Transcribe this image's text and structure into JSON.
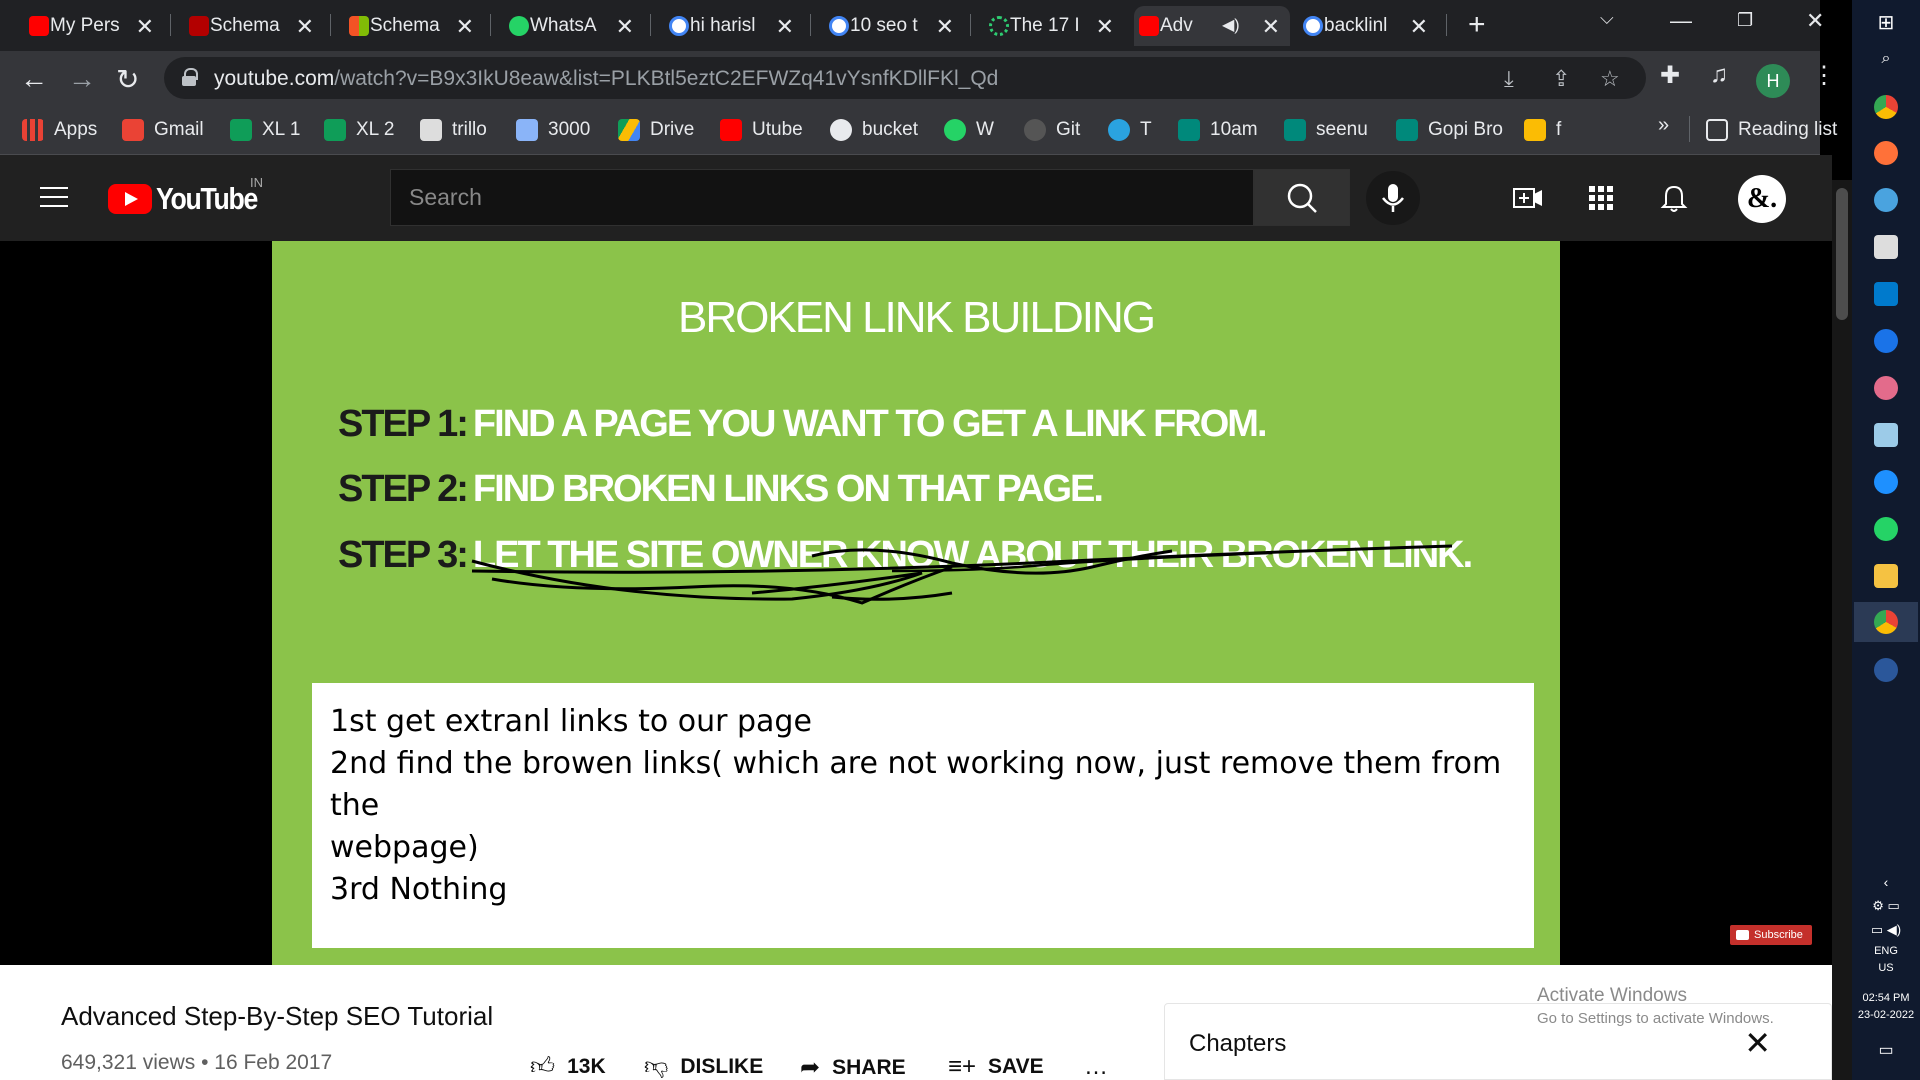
{
  "tabs": [
    {
      "title": "My Pers",
      "icon": "youtube-icon",
      "color": "#ff0000"
    },
    {
      "title": "Schema",
      "icon": "schema-org-icon",
      "color": "#b30000"
    },
    {
      "title": "Schema",
      "icon": "microsoft-icon",
      "color": "#f35325"
    },
    {
      "title": "WhatsA",
      "icon": "whatsapp-icon",
      "color": "#25d366"
    },
    {
      "title": "hi harisl",
      "icon": "google-icon",
      "color": "#ffffff"
    },
    {
      "title": "10 seo t",
      "icon": "google-icon",
      "color": "#ffffff"
    },
    {
      "title": "The 17 I",
      "icon": "spinner-icon",
      "color": "#2ecc71"
    },
    {
      "title": "Adv",
      "icon": "youtube-icon",
      "color": "#ff0000"
    },
    {
      "title": "backlinl",
      "icon": "google-icon",
      "color": "#ffffff"
    }
  ],
  "address": {
    "domain": "youtube.com",
    "path": "/watch?v=B9x3IkU8eaw&list=PLKBtl5eztC2EFWZq41vYsnfKDllFKl_Qd"
  },
  "bookmarks": [
    {
      "label": "Apps",
      "icon": "apps-grid-icon",
      "color": "#e94235"
    },
    {
      "label": "Gmail",
      "icon": "gmail-icon",
      "color": "#ea4335"
    },
    {
      "label": "XL 1",
      "icon": "sheets-icon",
      "color": "#0f9d58"
    },
    {
      "label": "XL 2",
      "icon": "sheets-icon",
      "color": "#0f9d58"
    },
    {
      "label": "trillo",
      "icon": "trello-icon",
      "color": "#dddddd"
    },
    {
      "label": "3000",
      "icon": "bookmark-site-icon",
      "color": "#8ab4f8"
    },
    {
      "label": "Drive",
      "icon": "drive-icon",
      "color": "#fbbc04"
    },
    {
      "label": "Utube",
      "icon": "youtube-icon",
      "color": "#ff0000"
    },
    {
      "label": "bucket",
      "icon": "globe-icon",
      "color": "#e8eaed"
    },
    {
      "label": "W",
      "icon": "whatsapp-icon",
      "color": "#25d366"
    },
    {
      "label": "Git",
      "icon": "github-icon",
      "color": "#555555"
    },
    {
      "label": "T",
      "icon": "telegram-icon",
      "color": "#2aa3e0"
    },
    {
      "label": "10am",
      "icon": "meet-icon",
      "color": "#00897b"
    },
    {
      "label": "seenu",
      "icon": "meet-icon",
      "color": "#00897b"
    },
    {
      "label": "Gopi Bro",
      "icon": "meet-icon",
      "color": "#00897b"
    },
    {
      "label": "f",
      "icon": "sticky-note-icon",
      "color": "#fbbc04"
    }
  ],
  "reading_list": "Reading list",
  "youtube": {
    "logo_text": "YouTube",
    "country_code": "IN",
    "search_placeholder": "Search",
    "avatar_text": "&."
  },
  "slide": {
    "title": "BROKEN LINK BUILDING",
    "steps": [
      {
        "label": "STEP 1:",
        "text": "FIND A PAGE YOU WANT TO GET A LINK FROM."
      },
      {
        "label": "STEP 2:",
        "text": "FIND BROKEN LINKS ON THAT PAGE."
      },
      {
        "label": "STEP 3:",
        "text": "LET THE SITE OWNER KNOW ABOUT THEIR BROKEN LINK."
      }
    ],
    "notes": [
      "1st get extranl links to our page",
      "2nd find the browen links( which are not working now, just remove them from the",
      "webpage)",
      "3rd Nothing"
    ],
    "subscribe_label": "Subscribe",
    "background_color": "#8bc34a"
  },
  "video": {
    "title": "Advanced Step-By-Step SEO Tutorial",
    "meta": "649,321 views • 16 Feb 2017",
    "like_count": "13K",
    "dislike_label": "DISLIKE",
    "share_label": "SHARE",
    "save_label": "SAVE",
    "chapters_label": "Chapters"
  },
  "watermark": {
    "line1": "Activate Windows",
    "line2": "Go to Settings to activate Windows."
  },
  "taskbar": {
    "language": "ENG",
    "region": "US",
    "time": "02:54 PM",
    "date": "23-02-2022"
  }
}
